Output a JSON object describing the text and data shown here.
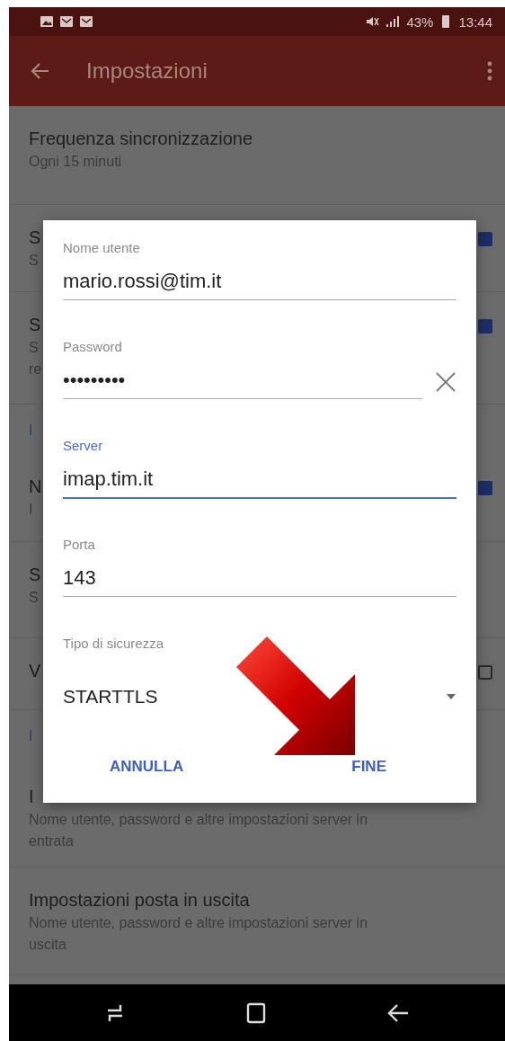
{
  "status_bar": {
    "battery": "43%",
    "time": "13:44"
  },
  "app_bar": {
    "title": "Impostazioni"
  },
  "settings": [
    {
      "kind": "item",
      "title": "Frequenza sincronizzazione",
      "subtitle": [
        "Ogni 15 minuti"
      ]
    },
    {
      "kind": "item",
      "title": "S",
      "subtitle": [
        "S"
      ],
      "checked": true
    },
    {
      "kind": "item",
      "title": "S",
      "subtitle": [
        "S",
        "re"
      ],
      "checked": true
    },
    {
      "kind": "section",
      "title": "I"
    },
    {
      "kind": "item",
      "title": "N",
      "subtitle": [
        "I"
      ],
      "checked": true
    },
    {
      "kind": "item",
      "title": "S",
      "subtitle": [
        "S"
      ]
    },
    {
      "kind": "item",
      "title": "V",
      "checked": false
    },
    {
      "kind": "section",
      "title": "I"
    },
    {
      "kind": "item",
      "title": "I",
      "subtitle": [
        "Nome utente, password e altre impostazioni server in",
        "entrata"
      ]
    },
    {
      "kind": "item",
      "title": "Impostazioni posta in uscita",
      "subtitle": [
        "Nome utente, password e altre impostazioni server in",
        "uscita"
      ]
    }
  ],
  "dialog": {
    "fields": [
      {
        "kind": "text",
        "label": "Nome utente",
        "value": "mario.rossi@tim.it",
        "focused": false
      },
      {
        "kind": "password",
        "label": "Password",
        "value": "•••••••••",
        "focused": false
      },
      {
        "kind": "text",
        "label": "Server",
        "value": "imap.tim.it",
        "focused": true
      },
      {
        "kind": "text",
        "label": "Porta",
        "value": "143",
        "focused": false
      },
      {
        "kind": "dropdown",
        "label": "Tipo di sicurezza",
        "value": "STARTTLS",
        "focused": false
      }
    ],
    "buttons": [
      "ANNULLA",
      "FINE"
    ]
  }
}
